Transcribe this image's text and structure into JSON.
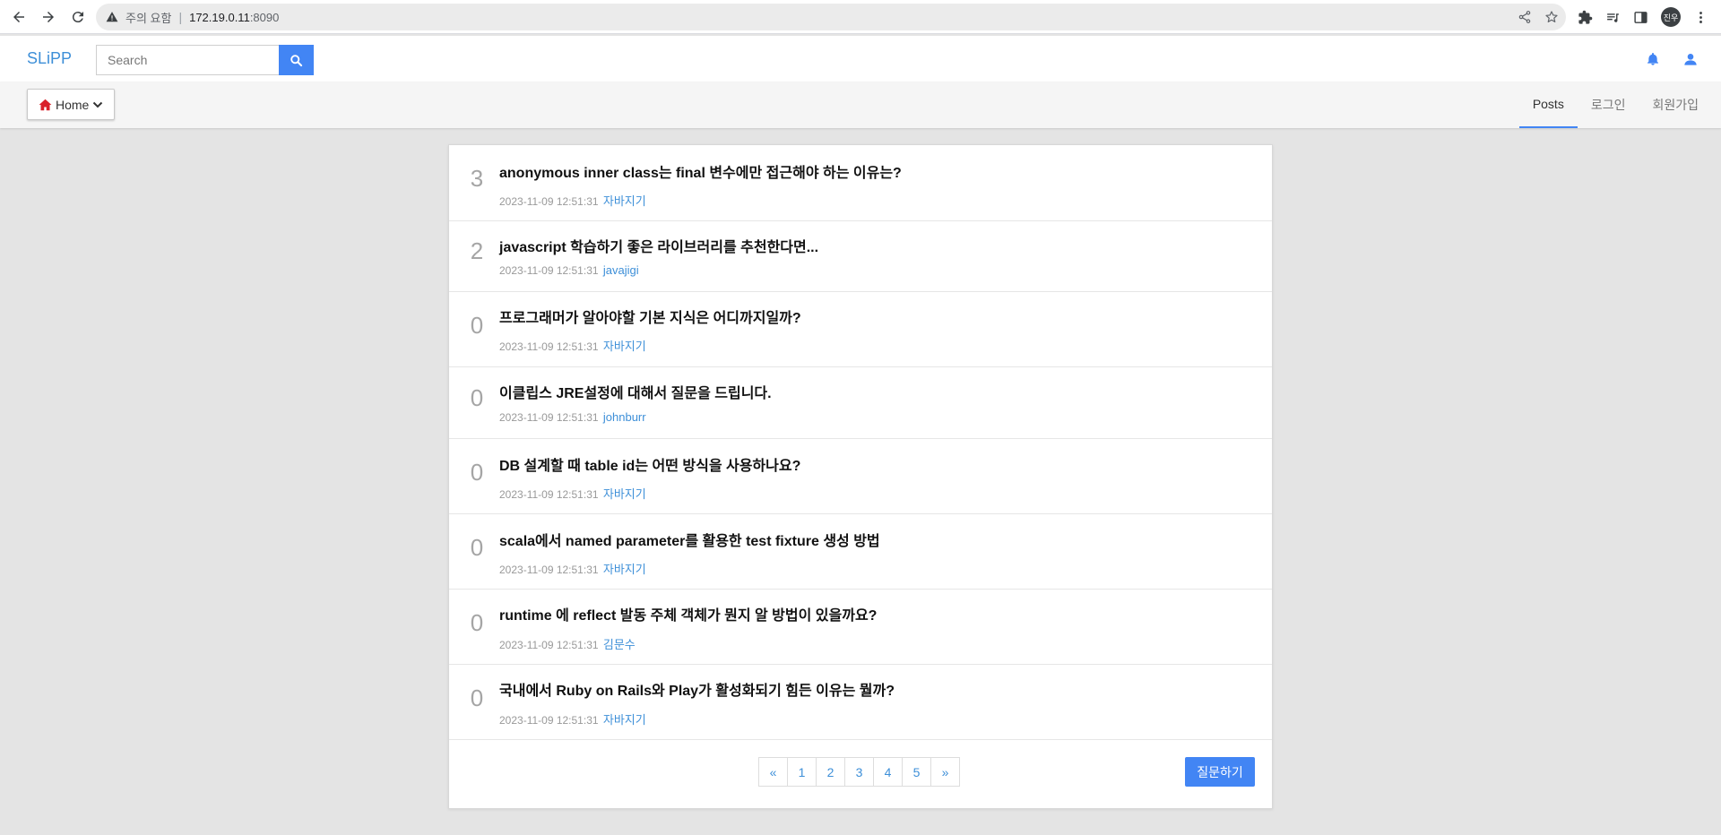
{
  "browser": {
    "warning_label": "주의 요함",
    "url_host": "172.19.0.11",
    "url_port": ":8090",
    "profile_initials": "진우"
  },
  "header": {
    "brand": "SLiPP",
    "search_placeholder": "Search"
  },
  "subnav": {
    "home_label": "Home",
    "tabs": [
      {
        "label": "Posts"
      },
      {
        "label": "로그인"
      },
      {
        "label": "회원가입"
      }
    ]
  },
  "posts": [
    {
      "count": "3",
      "title": "anonymous inner class는 final 변수에만 접근해야 하는 이유는?",
      "date": "2023-11-09 12:51:31",
      "author": "자바지기"
    },
    {
      "count": "2",
      "title": "javascript 학습하기 좋은 라이브러리를 추천한다면...",
      "date": "2023-11-09 12:51:31",
      "author": "javajigi"
    },
    {
      "count": "0",
      "title": "프로그래머가 알아야할 기본 지식은 어디까지일까?",
      "date": "2023-11-09 12:51:31",
      "author": "자바지기"
    },
    {
      "count": "0",
      "title": "이클립스 JRE설정에 대해서 질문을 드립니다.",
      "date": "2023-11-09 12:51:31",
      "author": "johnburr"
    },
    {
      "count": "0",
      "title": "DB 설계할 때 table id는 어떤 방식을 사용하나요?",
      "date": "2023-11-09 12:51:31",
      "author": "자바지기"
    },
    {
      "count": "0",
      "title": "scala에서 named parameter를 활용한 test fixture 생성 방법",
      "date": "2023-11-09 12:51:31",
      "author": "자바지기"
    },
    {
      "count": "0",
      "title": "runtime 에 reflect 발동 주체 객체가 뭔지 알 방법이 있을까요?",
      "date": "2023-11-09 12:51:31",
      "author": "김문수"
    },
    {
      "count": "0",
      "title": "국내에서 Ruby on Rails와 Play가 활성화되기 힘든 이유는 뭘까?",
      "date": "2023-11-09 12:51:31",
      "author": "자바지기"
    }
  ],
  "pagination": [
    "«",
    "1",
    "2",
    "3",
    "4",
    "5",
    "»"
  ],
  "ask_button": "질문하기",
  "colors": {
    "accent": "#4285f4",
    "link": "#3d8fd8",
    "home_icon": "#d9202a"
  }
}
